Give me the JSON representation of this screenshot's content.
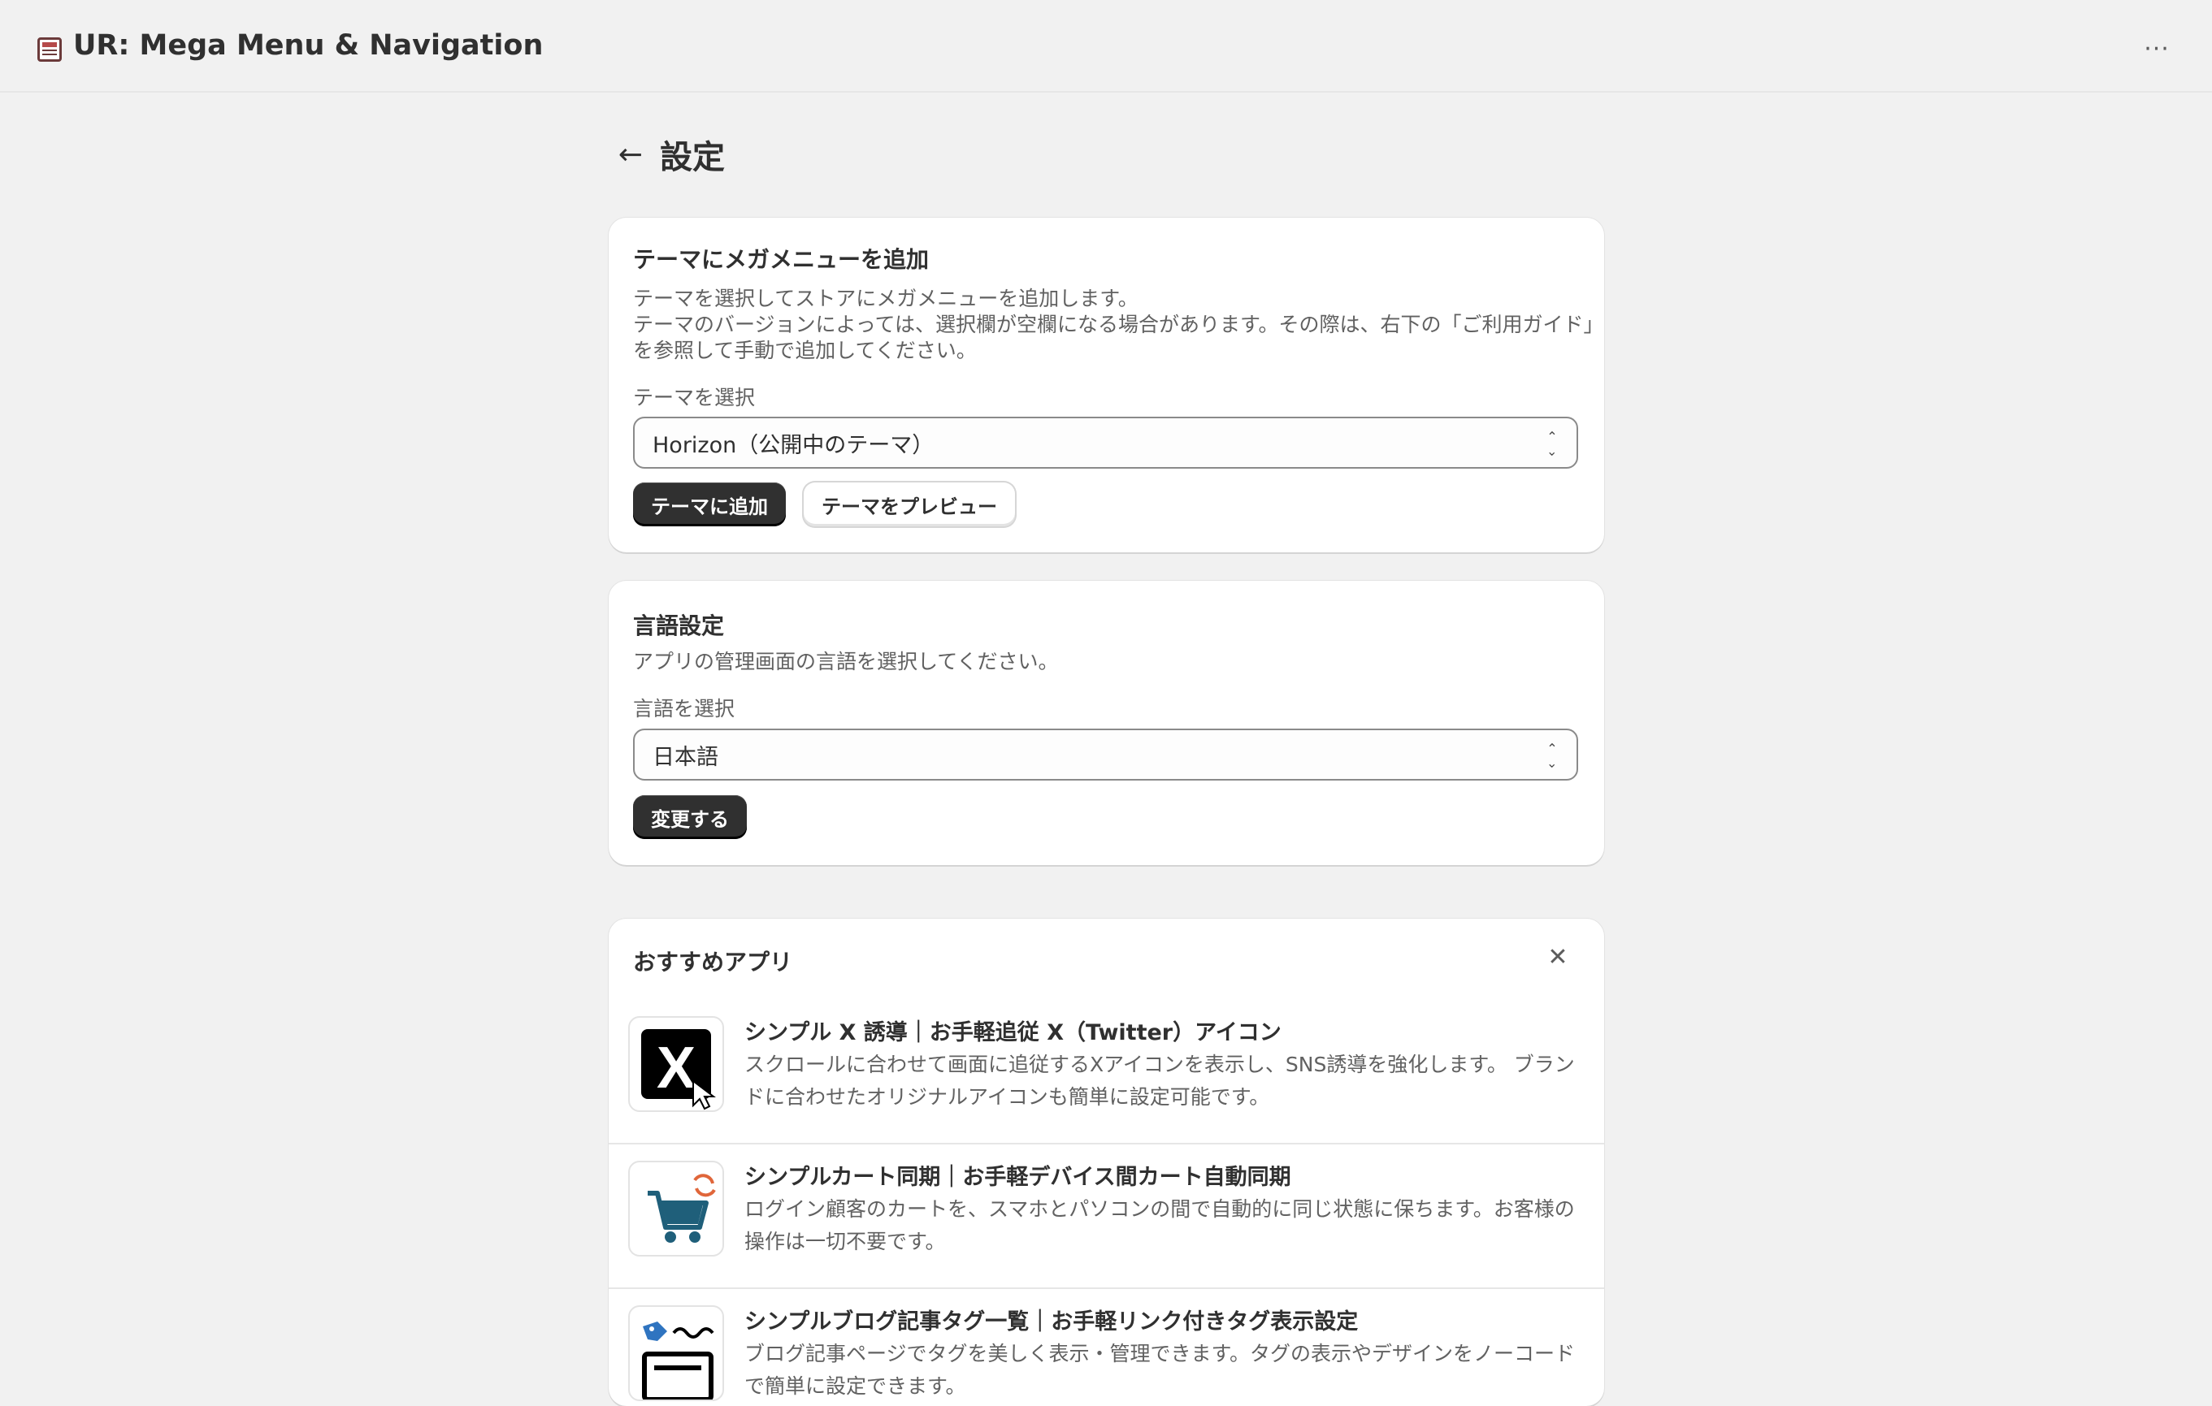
{
  "app": {
    "title": "UR: Mega Menu & Navigation",
    "more_label": "···"
  },
  "page": {
    "title": "設定",
    "back_label": "←"
  },
  "theme_card": {
    "heading": "テーマにメガメニューを追加",
    "description": [
      "テーマを選択してストアにメガメニューを追加します。",
      "テーマのバージョンによっては、選択欄が空欄になる場合があります。その際は、右下の「ご利用ガイド」",
      "を参照して手動で追加してください。"
    ],
    "field_label": "テーマを選択",
    "select_value": "Horizon（公開中のテーマ）",
    "add_button": "テーマに追加",
    "preview_button": "テーマをプレビュー"
  },
  "language_card": {
    "heading": "言語設定",
    "description": "アプリの管理画面の言語を選択してください。",
    "field_label": "言語を選択",
    "select_value": "日本語",
    "change_button": "変更する"
  },
  "recommended": {
    "heading": "おすすめアプリ",
    "close_label": "✕",
    "items": [
      {
        "title": "シンプル X 誘導｜お手軽追従 X（Twitter）アイコン",
        "description": "スクロールに合わせて画面に追従するXアイコンを表示し、SNS誘導を強化します。 ブランドに合わせたオリジナルアイコンも簡単に設定可能です。",
        "icon": "x-logo-cursor-icon"
      },
      {
        "title": "シンプルカート同期｜お手軽デバイス間カート自動同期",
        "description": "ログイン顧客のカートを、スマホとパソコンの間で自動的に同じ状態に保ちます。お客様の操作は一切不要です。",
        "icon": "cart-sync-icon"
      },
      {
        "title": "シンプルブログ記事タグ一覧｜お手軽リンク付きタグ表示設定",
        "description": "ブログ記事ページでタグを美しく表示・管理できます。タグの表示やデザインをノーコードで簡単に設定できます。",
        "icon": "blog-tag-icon"
      }
    ]
  },
  "colors": {
    "background": "#f1f1f1",
    "card": "#ffffff",
    "primary_button": "#303030",
    "text": "#303030",
    "subdued_text": "#616161",
    "cart_blue": "#1f5f7a",
    "sync_orange": "#e0663a",
    "tag_blue": "#2f74c0"
  }
}
